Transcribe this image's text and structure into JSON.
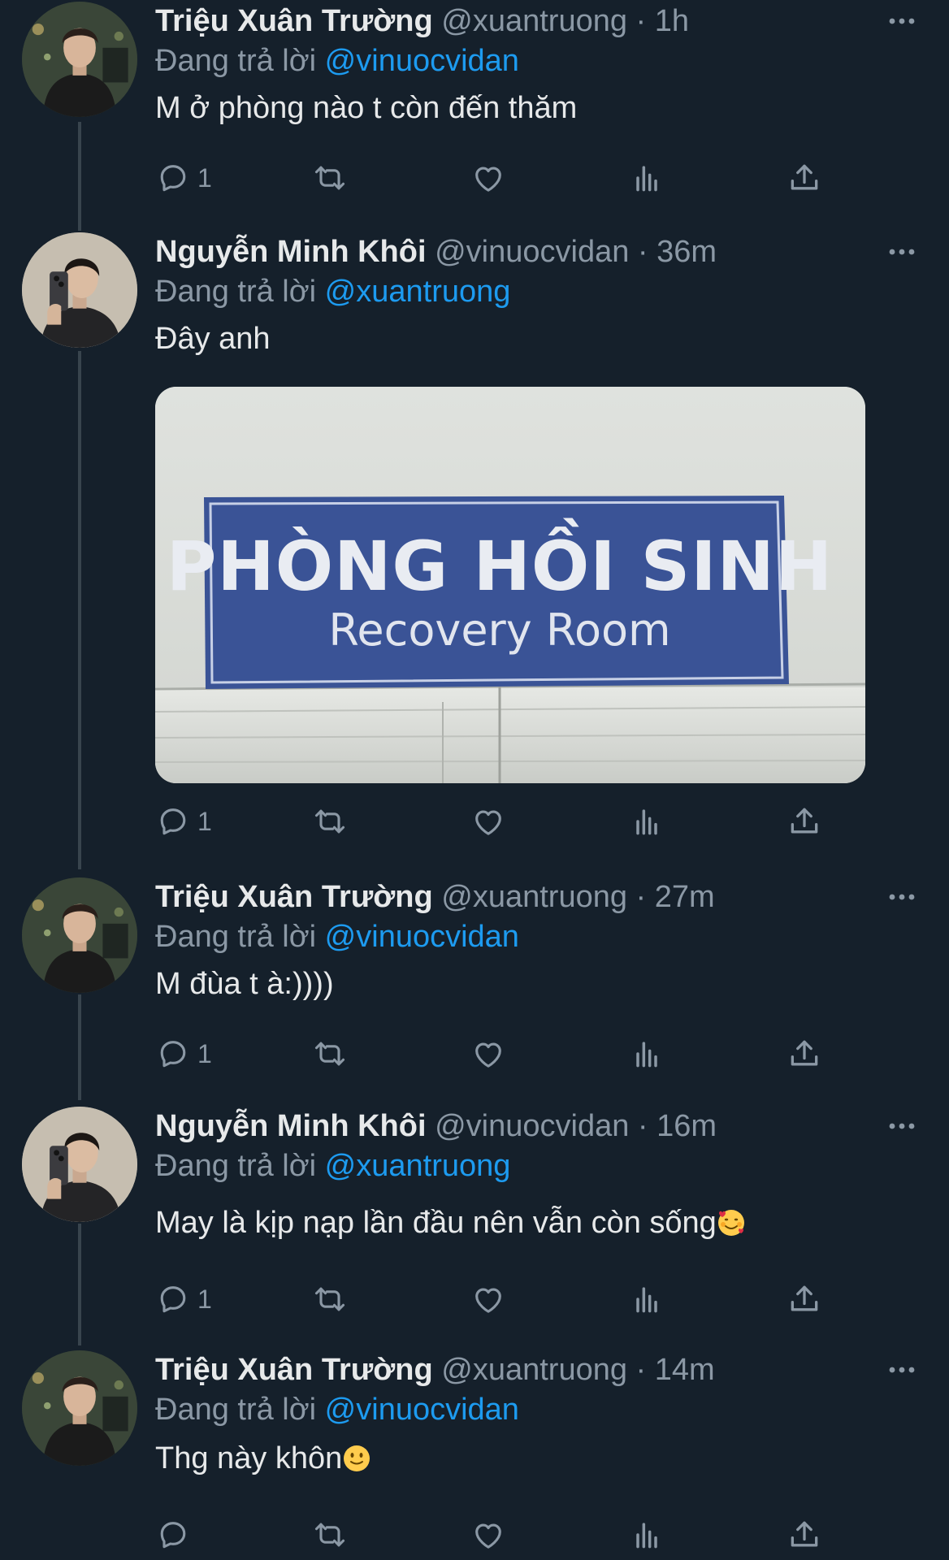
{
  "colors": {
    "background": "#15202b",
    "secondary_text": "#8b98a5",
    "mention": "#1d9bf0",
    "thread_line": "#38444d"
  },
  "tweets": [
    {
      "name": "Triệu Xuân Trường",
      "handle": "@xuantruong",
      "separator": "·",
      "time": "1h",
      "reply_prefix": "Đang trả lời",
      "reply_to": "@vinuocvidan",
      "text": "M ở phòng nào t còn đến thăm",
      "reply_count": "1"
    },
    {
      "name": "Nguyễn Minh Khôi",
      "handle": "@vinuocvidan",
      "separator": "·",
      "time": "36m",
      "reply_prefix": "Đang trả lời",
      "reply_to": "@xuantruong",
      "text": "Đây anh",
      "reply_count": "1",
      "media": {
        "sign_title": "PHÒNG HỒI SINH",
        "sign_subtitle": "Recovery Room"
      }
    },
    {
      "name": "Triệu Xuân Trường",
      "handle": "@xuantruong",
      "separator": "·",
      "time": "27m",
      "reply_prefix": "Đang trả lời",
      "reply_to": "@vinuocvidan",
      "text": "M đùa t à:))))",
      "reply_count": "1"
    },
    {
      "name": "Nguyễn Minh Khôi",
      "handle": "@vinuocvidan",
      "separator": "·",
      "time": "16m",
      "reply_prefix": "Đang trả lời",
      "reply_to": "@xuantruong",
      "text": "May là kịp nạp lần đầu nên vẫn còn sống",
      "emoji": "smiling-face-with-hearts",
      "reply_count": "1"
    },
    {
      "name": "Triệu Xuân Trường",
      "handle": "@xuantruong",
      "separator": "·",
      "time": "14m",
      "reply_prefix": "Đang trả lời",
      "reply_to": "@vinuocvidan",
      "text": "Thg này khôn",
      "emoji": "slightly-smiling-face",
      "reply_count": ""
    }
  ]
}
